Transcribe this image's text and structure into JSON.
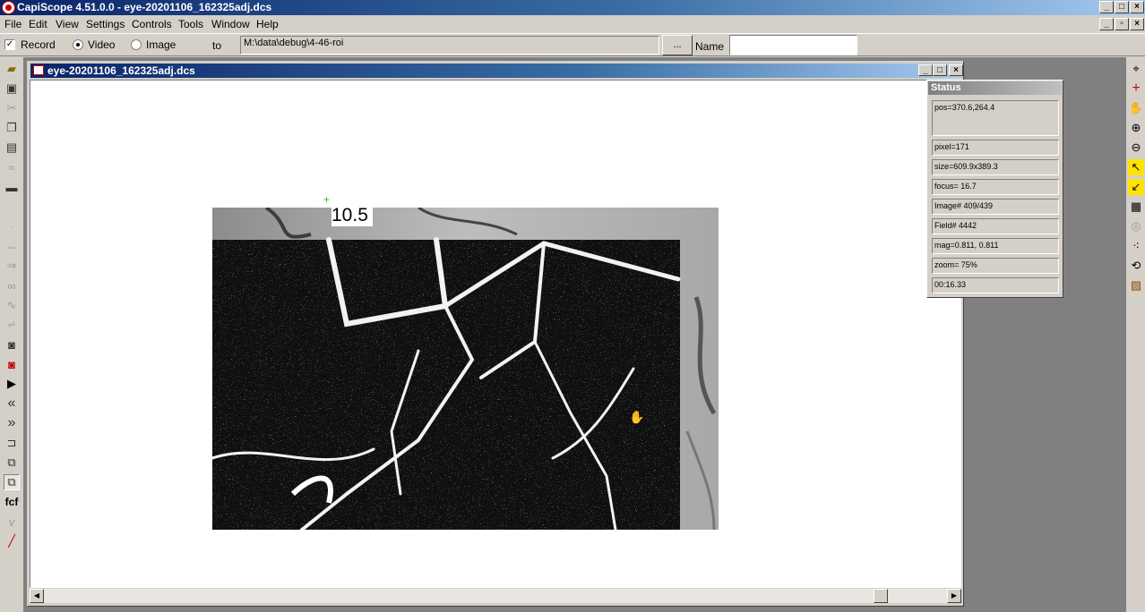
{
  "window": {
    "title": "CapiScope 4.51.0.0 - eye-20201106_162325adj.dcs"
  },
  "menu": [
    "File",
    "Edit",
    "View",
    "Settings",
    "Controls",
    "Tools",
    "Window",
    "Help"
  ],
  "options": {
    "record_label": "Record",
    "record_checked": true,
    "video_label": "Video",
    "image_label": "Image",
    "selected_mode": "Video",
    "to_label": "to",
    "path_value": "M:\\data\\debug\\4-46-roi",
    "browse_label": "...",
    "name_label": "Name",
    "name_value": ""
  },
  "document": {
    "title": "eye-20201106_162325adj.dcs"
  },
  "overlay": {
    "measure_label": "10.5"
  },
  "status_panel": {
    "title": "Status",
    "pos": "pos=370.6,264.4",
    "pixel": "pixel=171",
    "size": "size=609.9x389.3",
    "focus": "focus= 16.7",
    "image": "Image# 409/439",
    "field": "Field# 4442",
    "mag": "mag=0.811, 0.811",
    "zoom": "zoom=  75%",
    "time": "00:16.33"
  },
  "left_tools": [
    "open-icon",
    "save-icon",
    "cut-icon",
    "copy-icon",
    "paste-icon",
    "draw-icon",
    "line-icon",
    "dot-icon",
    "small-dot-icon",
    "move-icon",
    "move2-icon",
    "glasses-icon",
    "wave-icon",
    "wave2-icon",
    "camera-icon",
    "red-camera-icon",
    "play-icon",
    "rewind-icon",
    "fast-forward-icon",
    "loop-icon",
    "layers-icon",
    "layers2-icon",
    "fcf-icon",
    "v-icon",
    "line-tool-icon"
  ],
  "left_tool_fcf_label": "fcf",
  "left_tool_v_label": "v",
  "right_tools": [
    "crosshair-icon",
    "red-crosshair-icon",
    "hand-icon",
    "zoom-in-icon",
    "zoom-out-icon",
    "yellow-arrow-icon",
    "yellow-arrow2-icon",
    "grid-icon",
    "target-icon",
    "points-icon",
    "rotate-icon",
    "image-edit-icon"
  ],
  "colors": {
    "title_start": "#0a246a",
    "title_end": "#a6caf0",
    "face": "#d4d0c8",
    "mdi_bg": "#808080"
  }
}
